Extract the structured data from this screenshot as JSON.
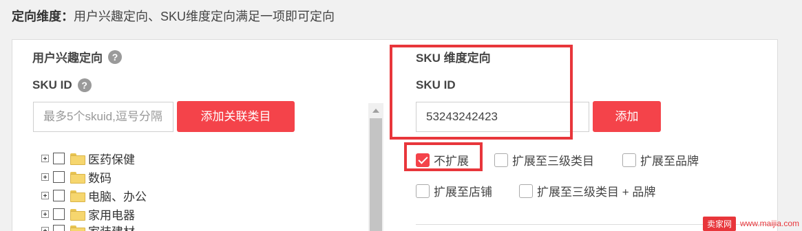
{
  "header": {
    "title": "定向维度：",
    "description": "用户兴趣定向、SKU维度定向满足一项即可定向"
  },
  "interest": {
    "title": "用户兴趣定向",
    "sku_label": "SKU ID",
    "input_placeholder": "最多5个skuid,逗号分隔",
    "add_button": "添加关联类目",
    "tree": [
      {
        "label": "医药保健"
      },
      {
        "label": "数码"
      },
      {
        "label": "电脑、办公"
      },
      {
        "label": "家用电器"
      },
      {
        "label": "家装建材"
      }
    ]
  },
  "sku_dimension": {
    "title": "SKU 维度定向",
    "sku_label": "SKU ID",
    "input_value": "53243242423",
    "add_button": "添加",
    "options": [
      {
        "label": "不扩展",
        "checked": true
      },
      {
        "label": "扩展至三级类目",
        "checked": false
      },
      {
        "label": "扩展至品牌",
        "checked": false
      },
      {
        "label": "扩展至店铺",
        "checked": false
      },
      {
        "label": "扩展至三级类目 + 品牌",
        "checked": false
      }
    ]
  },
  "colors": {
    "accent": "#f4434a",
    "highlight": "#e8363b"
  },
  "icons": {
    "help": "help-icon",
    "folder": "folder-icon",
    "expand": "expand-icon"
  },
  "watermark": {
    "logo": "卖家网",
    "url": "www.maijia.com"
  }
}
